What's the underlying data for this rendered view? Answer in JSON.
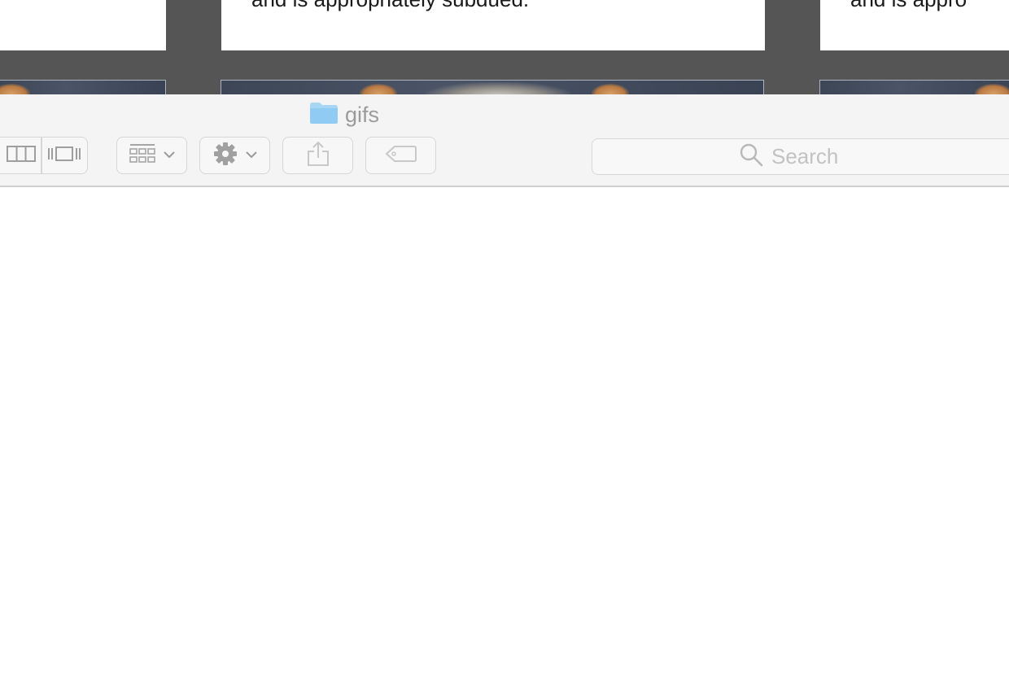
{
  "background_page": {
    "card_middle_text": "and is appropriately subdued.",
    "card_right_text": "and is appro"
  },
  "finder": {
    "window_title": "gifs",
    "title_icon": "folder-icon",
    "toolbar": {
      "view_buttons": [
        {
          "name": "column-view",
          "icon": "column-view-icon"
        },
        {
          "name": "cover-flow-view",
          "icon": "cover-flow-icon"
        }
      ],
      "arrange_icon": "grid-arrange-icon",
      "action_icon": "gear-icon",
      "share_icon": "share-icon",
      "tag_icon": "tag-icon"
    },
    "search": {
      "placeholder": "Search",
      "value": "",
      "icon": "search-icon"
    }
  },
  "colors": {
    "folder": "#8fcbf2",
    "toolbar_bg": "#f4f4f4",
    "page_bg": "#555555"
  }
}
